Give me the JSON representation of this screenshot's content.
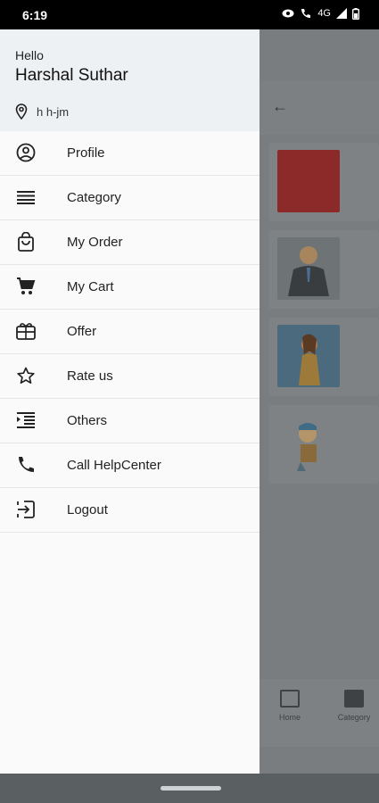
{
  "status_bar": {
    "time": "6:19",
    "network": "4G"
  },
  "drawer": {
    "greeting": "Hello",
    "user_name": "Harshal Suthar",
    "location": "h h-jm",
    "menu": [
      {
        "label": "Profile",
        "icon": "account-circle-icon"
      },
      {
        "label": "Category",
        "icon": "list-lines-icon"
      },
      {
        "label": "My Order",
        "icon": "shopping-bag-icon"
      },
      {
        "label": "My Cart",
        "icon": "cart-icon"
      },
      {
        "label": "Offer",
        "icon": "gift-card-icon"
      },
      {
        "label": "Rate us",
        "icon": "star-icon"
      },
      {
        "label": "Others",
        "icon": "format-indent-icon"
      },
      {
        "label": "Call HelpCenter",
        "icon": "phone-icon"
      },
      {
        "label": "Logout",
        "icon": "logout-icon"
      }
    ]
  },
  "background_app": {
    "bottom_nav": [
      {
        "label": "Home"
      },
      {
        "label": "Category"
      }
    ]
  },
  "colors": {
    "drawer_bg": "#fafafa",
    "header_bg": "#eef1f3",
    "scrim": "#7a7d80"
  }
}
